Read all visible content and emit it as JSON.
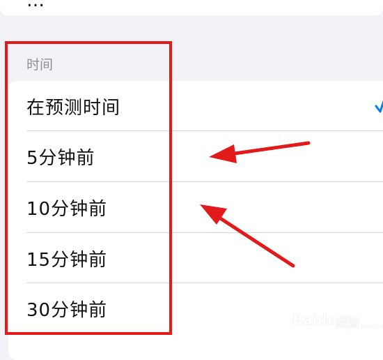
{
  "top_card": {
    "partial_text": "…"
  },
  "section": {
    "header": "时间"
  },
  "options": [
    {
      "label": "在预测时间",
      "selected": true
    },
    {
      "label": "5分钟前",
      "selected": false
    },
    {
      "label": "10分钟前",
      "selected": false
    },
    {
      "label": "15分钟前",
      "selected": false
    },
    {
      "label": "30分钟前",
      "selected": false
    }
  ],
  "annotation": {
    "color": "#e21a1a"
  },
  "watermark": {
    "brand": "Baidu",
    "cn": "经验",
    "url": "jingyan.baidu.com"
  },
  "colors": {
    "background": "#f2f2f7",
    "card": "#ffffff",
    "section_header": "#8e8e93",
    "checkmark": "#007aff"
  }
}
